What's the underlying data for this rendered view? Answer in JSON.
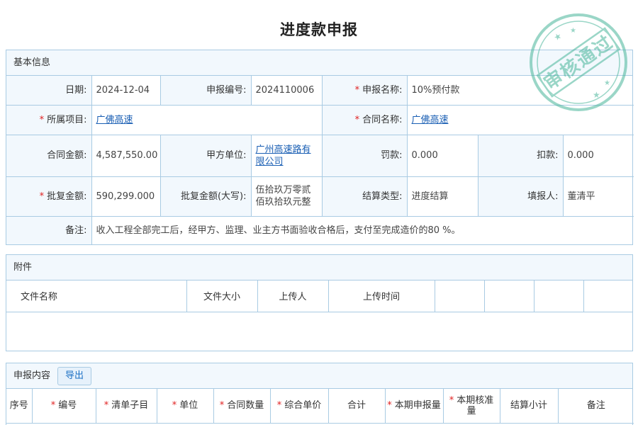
{
  "page": {
    "title": "进度款申报"
  },
  "basic": {
    "section_title": "基本信息",
    "date_label": "日期:",
    "date_value": "2024-12-04",
    "code_label": "申报编号:",
    "code_value": "2024110006",
    "name_label": "申报名称:",
    "name_value": "10%预付款",
    "project_label": "所属项目:",
    "project_value": "广佛高速",
    "contract_name_label": "合同名称:",
    "contract_name_value": "广佛高速",
    "contract_amount_label": "合同金额:",
    "contract_amount_value": "4,587,550.00",
    "party_a_label": "甲方单位:",
    "party_a_value": "广州高速路有限公司",
    "penalty_label": "罚款:",
    "penalty_value": "0.000",
    "deduction_label": "扣款:",
    "deduction_value": "0.000",
    "approved_label": "批复金额:",
    "approved_value": "590,299.000",
    "approved_upper_label": "批复金额(大写):",
    "approved_upper_value": "伍拾玖万零贰佰玖拾玖元整",
    "settle_type_label": "结算类型:",
    "settle_type_value": "进度结算",
    "filler_label": "填报人:",
    "filler_value": "董清平",
    "remark_label": "备注:",
    "remark_value": "收入工程全部完工后，经甲方、监理、业主方书面验收合格后，支付至完成造价的80 %。",
    "required_mark": "*"
  },
  "attachments": {
    "section_title": "附件",
    "columns": [
      "文件名称",
      "文件大小",
      "上传人",
      "上传时间",
      "",
      "",
      "",
      ""
    ]
  },
  "report": {
    "section_title": "申报内容",
    "export_label": "导出",
    "columns": [
      {
        "label": "序号",
        "required": false
      },
      {
        "label": "编号",
        "required": true
      },
      {
        "label": "清单子目",
        "required": true
      },
      {
        "label": "单位",
        "required": true
      },
      {
        "label": "合同数量",
        "required": true
      },
      {
        "label": "综合单价",
        "required": true
      },
      {
        "label": "合计",
        "required": false
      },
      {
        "label": "本期申报量",
        "required": true
      },
      {
        "label": "本期核准量",
        "required": true
      },
      {
        "label": "结算小计",
        "required": false
      },
      {
        "label": "备注",
        "required": false
      }
    ]
  },
  "stamp": {
    "text": "审核通过",
    "color": "#48b59a"
  },
  "colors": {
    "border": "#a9cbe3",
    "header_bg": "#f2f8fd",
    "link": "#1a5fb4",
    "required": "#e02020"
  }
}
